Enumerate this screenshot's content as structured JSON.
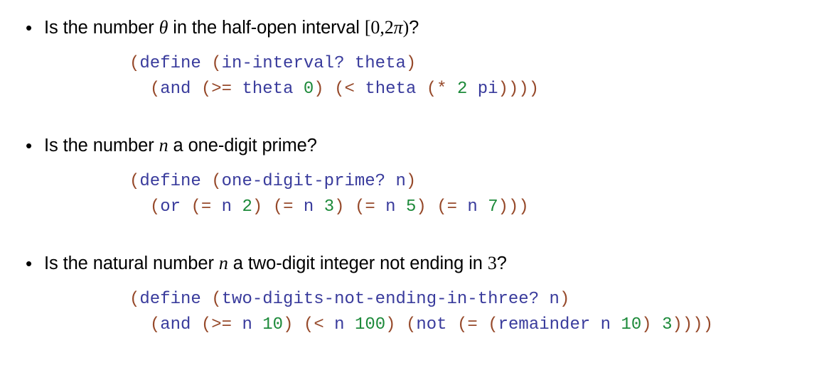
{
  "slide": {
    "background": "#ffffff",
    "colors": {
      "paren": "#96492a",
      "identifier": "#393b9c",
      "number": "#1d8a3a",
      "text": "#000000"
    },
    "bullet_glyph": "•",
    "items": [
      {
        "prompt": {
          "pre": "Is the number ",
          "math": "θ",
          "mid": " in the half-open interval ",
          "interval_open": "[",
          "interval_zero": "0",
          "interval_comma": ",",
          "interval_two": "2",
          "interval_pi": "π",
          "interval_close": ")",
          "post": "?"
        },
        "code": {
          "line1": {
            "p1": "(",
            "kw": "define",
            "sp1": " ",
            "p2": "(",
            "name": "in-interval?",
            "sp2": " ",
            "arg": "theta",
            "p3": ")"
          },
          "line2": {
            "indent": "  ",
            "p1": "(",
            "op1": "and",
            "sp1": " ",
            "p2": "(",
            "op2": ">=",
            "sp2": " ",
            "a1": "theta",
            "sp3": " ",
            "n1": "0",
            "p3": ")",
            "sp4": " ",
            "p4": "(",
            "op3": "<",
            "sp5": " ",
            "a2": "theta",
            "sp6": " ",
            "p5": "(",
            "op4": "*",
            "sp7": " ",
            "n2": "2",
            "sp8": " ",
            "a3": "pi",
            "p6": "))))"
          }
        }
      },
      {
        "prompt": {
          "pre": "Is the number ",
          "math": "n",
          "mid": " a one-digit prime",
          "post": "?"
        },
        "code": {
          "line1": {
            "p1": "(",
            "kw": "define",
            "sp1": " ",
            "p2": "(",
            "name": "one-digit-prime?",
            "sp2": " ",
            "arg": "n",
            "p3": ")"
          },
          "line2": {
            "indent": "  ",
            "p1": "(",
            "op1": "or",
            "sp1": " ",
            "t1p": "(",
            "t1op": "=",
            "t1a": " n ",
            "t1n": "2",
            "t1c": ")",
            "sp2": " ",
            "t2p": "(",
            "t2op": "=",
            "t2a": " n ",
            "t2n": "3",
            "t2c": ")",
            "sp3": " ",
            "t3p": "(",
            "t3op": "=",
            "t3a": " n ",
            "t3n": "5",
            "t3c": ")",
            "sp4": " ",
            "t4p": "(",
            "t4op": "=",
            "t4a": " n ",
            "t4n": "7",
            "t4c": ")))"
          }
        }
      },
      {
        "prompt": {
          "pre": "Is the natural number ",
          "math": "n",
          "mid": " a two-digit integer not ending in ",
          "math2": "3",
          "post": "?"
        },
        "code": {
          "line1": {
            "p1": "(",
            "kw": "define",
            "sp1": " ",
            "p2": "(",
            "name": "two-digits-not-ending-in-three?",
            "sp2": " ",
            "arg": "n",
            "p3": ")"
          },
          "line2": {
            "indent": "  ",
            "p1": "(",
            "op1": "and",
            "sp1": " ",
            "t1p": "(",
            "t1op": ">=",
            "t1a": " n ",
            "t1n": "10",
            "t1c": ")",
            "sp2": " ",
            "t2p": "(",
            "t2op": "<",
            "t2a": " n ",
            "t2n": "100",
            "t2c": ")",
            "sp3": " ",
            "t3p": "(",
            "t3op": "not",
            "sp4": " ",
            "t4p": "(",
            "t4op": "=",
            "sp5": " ",
            "t5p": "(",
            "t5fn": "remainder",
            "t5a": " n ",
            "t5n": "10",
            "t5c": ")",
            "sp6": " ",
            "t6n": "3",
            "t6c": "))))"
          }
        }
      }
    ]
  }
}
